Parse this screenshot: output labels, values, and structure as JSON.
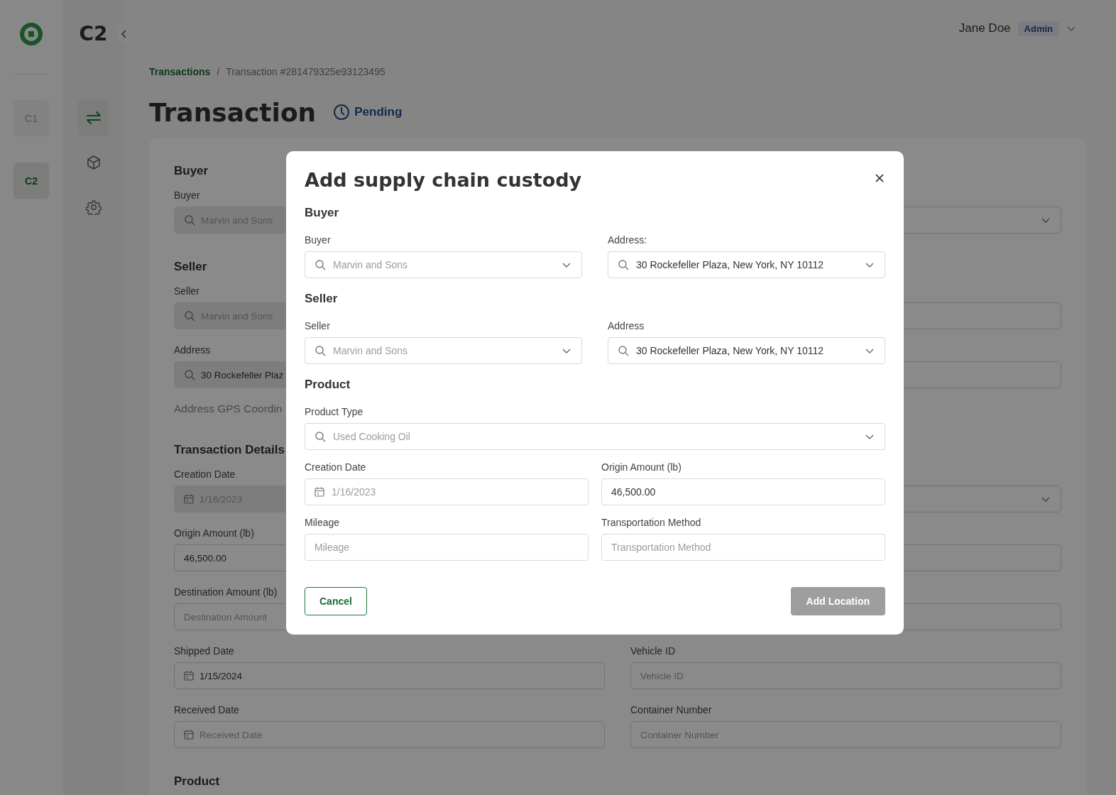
{
  "rail": {
    "items": [
      {
        "label": "C1",
        "selected": false
      },
      {
        "label": "C2",
        "selected": true
      }
    ]
  },
  "sidebar": {
    "title": "C2",
    "nav": [
      {
        "kind": "arrows",
        "selected": true
      },
      {
        "kind": "cube",
        "selected": false
      },
      {
        "kind": "gear",
        "selected": false
      }
    ]
  },
  "user": {
    "name": "Jane Doe",
    "role": "Admin"
  },
  "breadcrumb": {
    "link": "Transactions",
    "separator": "/",
    "current": "Transaction #281479325e93123495"
  },
  "page_title": "Transaction",
  "status": "Pending",
  "form": {
    "rows": [
      {
        "left": {
          "kind": "heading",
          "text": "Buyer"
        }
      },
      {
        "left": {
          "kind": "search",
          "label": "Buyer",
          "placeholder": "Marvin and Sons",
          "disabled": true
        },
        "right": {
          "kind": "select"
        }
      },
      {
        "left": {
          "kind": "heading",
          "text": "Seller"
        }
      },
      {
        "left": {
          "kind": "search",
          "label": "Seller",
          "placeholder": "Marvin and Sons",
          "disabled": true
        },
        "right": {
          "kind": "input"
        }
      },
      {
        "left": {
          "kind": "search",
          "label": "Address",
          "value": "30 Rockefeller Plaz",
          "disabled": true
        },
        "right": {
          "kind": "input"
        }
      },
      {
        "left": {
          "kind": "note",
          "text": "Address GPS Coordin"
        }
      },
      {
        "left": {
          "kind": "heading",
          "text": "Transaction Details"
        }
      },
      {
        "left": {
          "kind": "date",
          "label": "Creation Date",
          "placeholder": "1/16/2023",
          "disabled": true
        },
        "right": {
          "kind": "select"
        }
      },
      {
        "left": {
          "kind": "input",
          "label": "Origin Amount (lb)",
          "value": "46,500.00",
          "disabled": false
        },
        "right": {
          "kind": "input"
        }
      },
      {
        "left": {
          "kind": "input",
          "label": "Destination Amount (lb)",
          "placeholder": "Destination Amount",
          "disabled": false
        },
        "right": {
          "kind": "input"
        }
      },
      {
        "left": {
          "kind": "date",
          "label": "Shipped Date",
          "value": "1/15/2024",
          "disabled": false
        },
        "right": {
          "kind": "input",
          "label": "Vehicle ID",
          "placeholder": "Vehicle ID",
          "disabled": false
        }
      },
      {
        "left": {
          "kind": "date",
          "label": "Received Date",
          "placeholder": "Received Date",
          "disabled": false
        },
        "right": {
          "kind": "input",
          "label": "Container Number",
          "placeholder": "Container Number",
          "disabled": false
        }
      },
      {
        "left": {
          "kind": "heading",
          "text": "Product"
        }
      }
    ]
  },
  "modal": {
    "title": "Add supply chain custody",
    "sections": [
      {
        "heading": "Buyer",
        "rows": [
          [
            {
              "kind": "select",
              "label": "Buyer",
              "placeholder": "Marvin and Sons"
            },
            {
              "kind": "select",
              "label": "Address:",
              "value": "30 Rockefeller Plaza, New York, NY 10112"
            }
          ]
        ]
      },
      {
        "heading": "Seller",
        "rows": [
          [
            {
              "kind": "select",
              "label": "Seller",
              "placeholder": "Marvin and Sons"
            },
            {
              "kind": "select",
              "label": "Address",
              "value": "30 Rockefeller Plaza, New York, NY 10112"
            }
          ]
        ]
      },
      {
        "heading": "Product",
        "rows": [
          [
            {
              "kind": "select",
              "label": "Product Type",
              "placeholder": "Used Cooking Oil"
            }
          ],
          [
            {
              "kind": "date",
              "label": "Creation Date",
              "placeholder": "1/16/2023"
            },
            {
              "kind": "input",
              "label": "Origin Amount (lb)",
              "value": "46,500.00"
            }
          ],
          [
            {
              "kind": "input",
              "label": "Mileage",
              "placeholder": "Mileage"
            },
            {
              "kind": "input",
              "label": "Transportation Method",
              "placeholder": "Transportation Method"
            }
          ]
        ]
      }
    ],
    "cancel": "Cancel",
    "submit": {
      "label": "Add Location",
      "disabled": true
    }
  }
}
